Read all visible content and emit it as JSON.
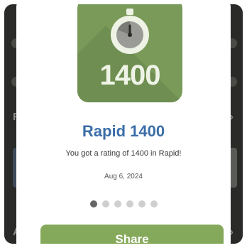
{
  "badge": {
    "number": "1400",
    "icon": "stopwatch-icon",
    "color": "#7a9a5a"
  },
  "achievement": {
    "title": "Rapid 1400",
    "description": "You got a rating of 1400 in Rapid!",
    "date": "Aug 6, 2024"
  },
  "pager": {
    "count": 6,
    "active_index": 0
  },
  "actions": {
    "share_label": "Share"
  },
  "background": {
    "letter_1": "F",
    "letter_2": "A"
  },
  "colors": {
    "title": "#3b6ea8",
    "button": "#85a95a",
    "overlay": "#2a2a28"
  }
}
